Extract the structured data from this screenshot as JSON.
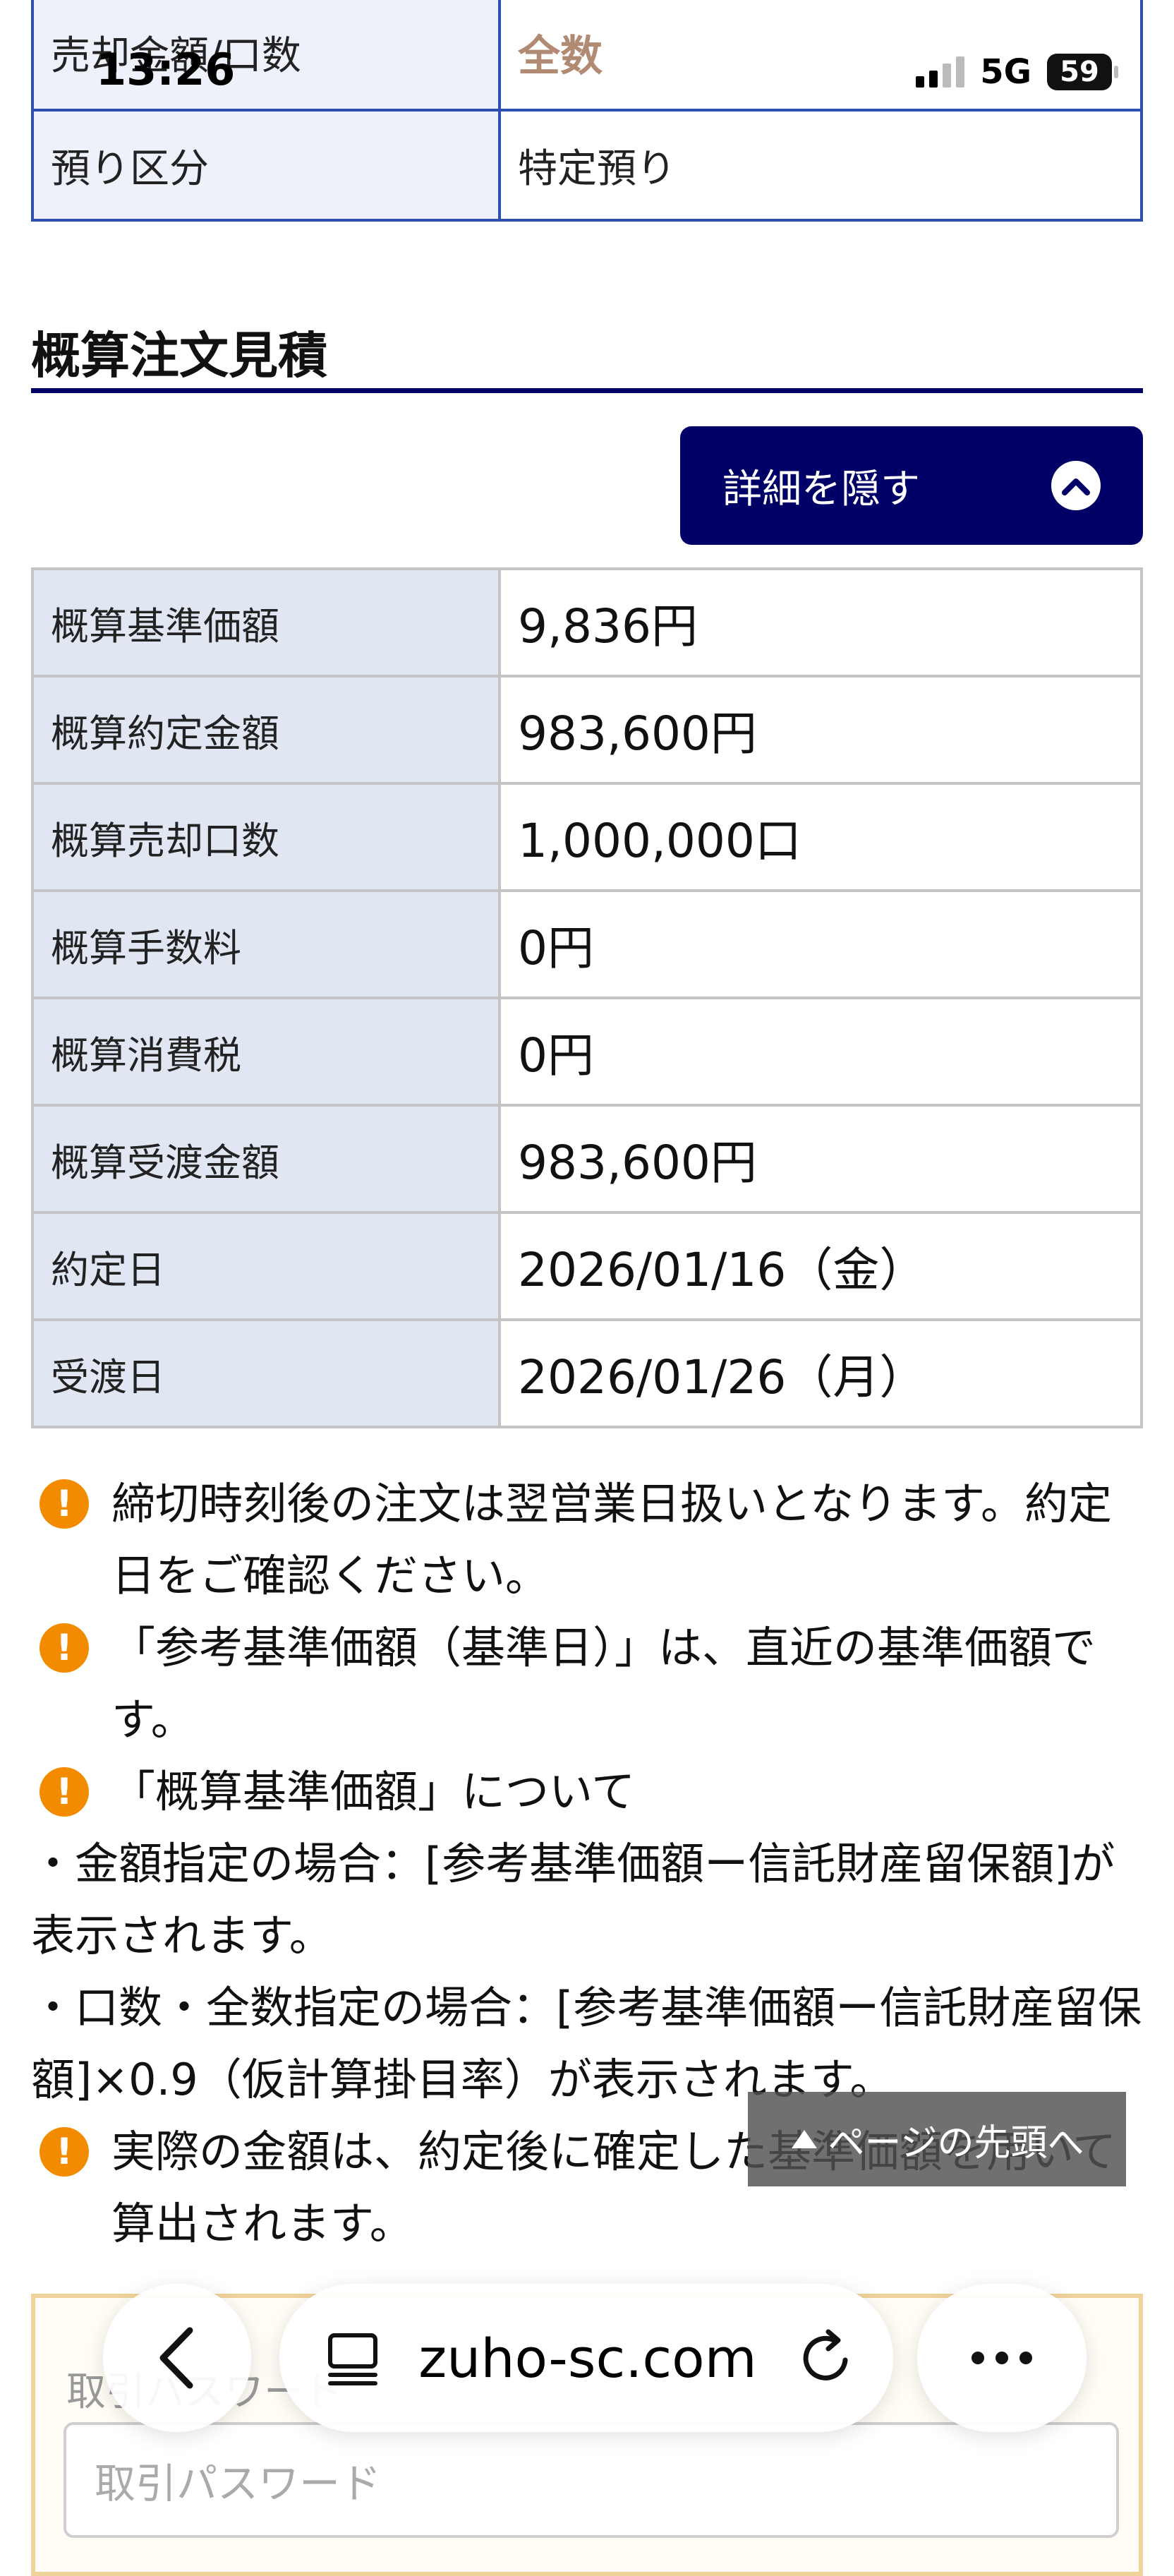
{
  "status_bar": {
    "time": "13:26",
    "network": "5G",
    "battery": "59"
  },
  "top_table": {
    "rows": [
      {
        "label": "売却金額/口数",
        "value": "全数"
      },
      {
        "label": "預り区分",
        "value": "特定預り"
      }
    ]
  },
  "estimate": {
    "title": "概算注文見積",
    "toggle_label": "詳細を隠す",
    "rows": [
      {
        "label": "概算基準価額",
        "value": "9,836円"
      },
      {
        "label": "概算約定金額",
        "value": "983,600円"
      },
      {
        "label": "概算売却口数",
        "value": "1,000,000口"
      },
      {
        "label": "概算手数料",
        "value": "0円"
      },
      {
        "label": "概算消費税",
        "value": "0円"
      },
      {
        "label": "概算受渡金額",
        "value": "983,600円"
      },
      {
        "label": "約定日",
        "value": "2026/01/16（金）"
      },
      {
        "label": "受渡日",
        "value": "2026/01/26（月）"
      }
    ]
  },
  "notes": {
    "n1": "締切時刻後の注文は翌営業日扱いとなります。約定日をご確認ください。",
    "n2": "「参考基準価額（基準日）」は、直近の基準価額です。",
    "n3": "「概算基準価額」について",
    "b1": "・金額指定の場合：[参考基準価額ー信託財産留保額]が表示されます。",
    "b2": "・口数・全数指定の場合：[参考基準価額ー信託財産留保額]×0.9（仮計算掛目率）が表示されます。",
    "n4": "実際の金額は、約定後に確定した基準価額を用いて算出されます。"
  },
  "back_to_top": "ページの先頭へ",
  "password": {
    "label": "取引パスワード",
    "placeholder": "取引パスワード"
  },
  "browser": {
    "url": "zuho-sc.com"
  },
  "icons": {
    "warning": "warning-circle-icon",
    "toggle": "chevron-up-icon",
    "back": "chevron-left-icon",
    "tabs": "tab-view-icon",
    "reload": "reload-icon",
    "more": "more-dots-icon"
  },
  "colors": {
    "navy": "#000066",
    "table_border": "#2c4fb0",
    "label_bg": "#e1e6f3",
    "warning": "#f28b00",
    "accent_text": "#b08a72"
  }
}
